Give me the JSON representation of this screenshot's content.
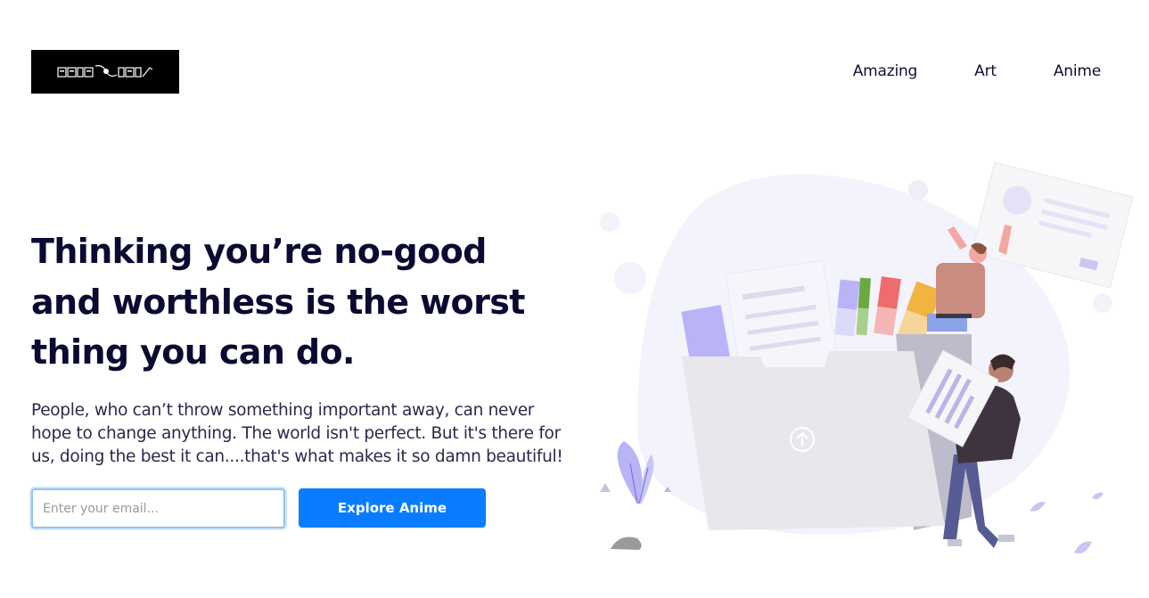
{
  "header": {
    "logo_text": "FAIRY TAIL",
    "nav": [
      {
        "label": "Amazing"
      },
      {
        "label": "Art"
      },
      {
        "label": "Anime"
      }
    ]
  },
  "hero": {
    "title": "Thinking you’re no-good and worthless is the worst thing you can do.",
    "text": "People, who can’t throw something important away, can never hope to change anything. The world isn't perfect. But it's there for us, doing the best it can....that's what makes it so damn beautiful!",
    "email_placeholder": "Enter your email...",
    "email_value": "",
    "cta_label": "Explore Anime"
  },
  "colors": {
    "accent": "#0a7cff",
    "heading": "#0a0a32",
    "illustration_purple": "#b9b4f5"
  },
  "icons": {
    "upload": "upload-arrow-icon"
  }
}
